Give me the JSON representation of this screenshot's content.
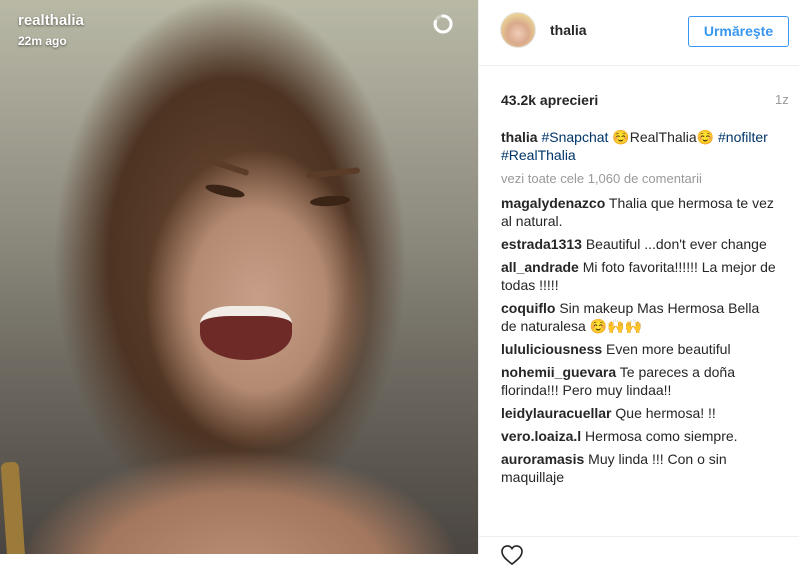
{
  "photo": {
    "overlay_username": "realthalia",
    "overlay_time": "22m ago",
    "timer_icon": "loading-ring-icon"
  },
  "header": {
    "username": "thalia",
    "follow_label": "Urmăreşte",
    "avatar_icon": "profile-avatar"
  },
  "stats": {
    "likes": "43.2k aprecieri",
    "age": "1z"
  },
  "caption": {
    "user": "thalia",
    "tag1": "#Snapchat",
    "text_mid": " ☺️RealThalia☺️",
    "tag2": "#nofilter",
    "tag3": "#RealThalia"
  },
  "view_all": "vezi toate cele 1,060 de comentarii",
  "comments": [
    {
      "user": "magalydenazco",
      "text": "Thalia que hermosa te vez al natural."
    },
    {
      "user": "estrada1313",
      "text": "Beautiful ...don't ever change"
    },
    {
      "user": "all_andrade",
      "text": "Mi foto favorita!!!!!! La mejor de todas !!!!!"
    },
    {
      "user": "coquiflo",
      "text": "Sin makeup Mas Hermosa Bella de naturalesa ☺️🙌🙌"
    },
    {
      "user": "lululiciousness",
      "text": "Even more beautiful"
    },
    {
      "user": "nohemii_guevara",
      "text": "Te pareces a doña florinda!!! Pero muy lindaa!!"
    },
    {
      "user": "leidylauracuellar",
      "text": "Que hermosa! !!"
    },
    {
      "user": "vero.loaiza.l",
      "text": "Hermosa como siempre."
    },
    {
      "user": "auroramasis",
      "text": "Muy linda !!! Con o sin maquillaje"
    }
  ],
  "colors": {
    "link": "#003569",
    "follow": "#3897f0",
    "muted": "#999999"
  },
  "actions": {
    "like_icon": "heart-icon"
  }
}
